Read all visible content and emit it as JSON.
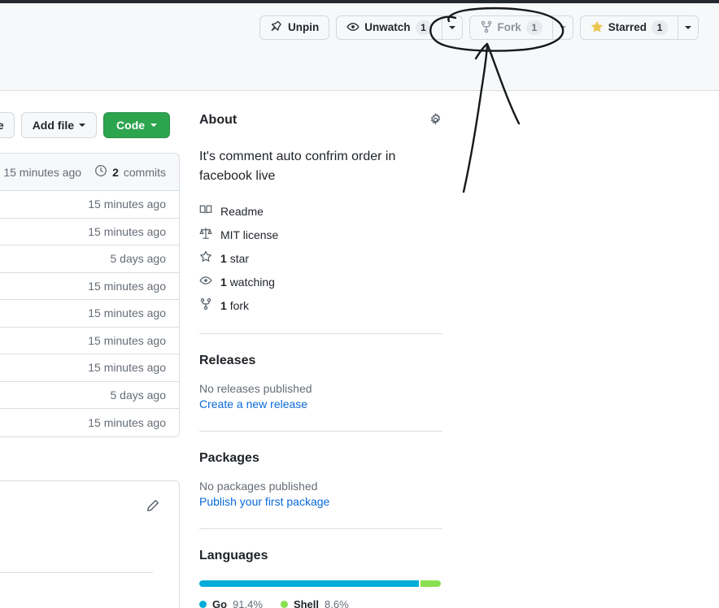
{
  "header": {
    "buttons": [
      {
        "id": "unpin",
        "label": "Unpin",
        "icon": "pin-icon",
        "count": null,
        "has_caret": false,
        "state": "enabled",
        "style": "default"
      },
      {
        "id": "unwatch",
        "label": "Unwatch",
        "icon": "eye-icon",
        "count": "1",
        "has_caret": true,
        "state": "enabled",
        "style": "default"
      },
      {
        "id": "fork",
        "label": "Fork",
        "icon": "fork-icon",
        "count": "1",
        "has_caret": true,
        "state": "disabled",
        "style": "default"
      },
      {
        "id": "starred",
        "label": "Starred",
        "icon": "star-filled-icon",
        "count": "1",
        "has_caret": true,
        "state": "enabled",
        "style": "default"
      }
    ]
  },
  "repo_toolbar": {
    "go_to_file_label": "le",
    "add_file_label": "Add file",
    "code_label": "Code"
  },
  "file_table": {
    "commit_row": {
      "time": "15 minutes ago",
      "history_icon": "history-icon",
      "commit_count": "2",
      "commit_label": "commits"
    },
    "rows": [
      {
        "time": "15 minutes ago"
      },
      {
        "time": "15 minutes ago"
      },
      {
        "time": "5 days ago"
      },
      {
        "time": "15 minutes ago"
      },
      {
        "time": "15 minutes ago"
      },
      {
        "time": "15 minutes ago"
      },
      {
        "time": "15 minutes ago"
      },
      {
        "time": "5 days ago"
      },
      {
        "time": "15 minutes ago"
      }
    ]
  },
  "readme_panel": {
    "edit_icon": "pencil-icon"
  },
  "about": {
    "title": "About",
    "settings_icon": "gear-icon",
    "description": "It's comment auto confrim order in facebook live",
    "items": [
      {
        "icon": "book-icon",
        "text": "Readme",
        "bold_prefix": ""
      },
      {
        "icon": "law-icon",
        "text": "MIT license",
        "bold_prefix": ""
      },
      {
        "icon": "star-icon",
        "text": "star",
        "bold_prefix": "1"
      },
      {
        "icon": "eye-icon",
        "text": "watching",
        "bold_prefix": "1"
      },
      {
        "icon": "fork-icon",
        "text": "fork",
        "bold_prefix": "1"
      }
    ]
  },
  "releases": {
    "title": "Releases",
    "empty_text": "No releases published",
    "link_text": "Create a new release"
  },
  "packages": {
    "title": "Packages",
    "empty_text": "No packages published",
    "link_text": "Publish your first package"
  },
  "languages": {
    "title": "Languages"
  },
  "chart_data": {
    "type": "bar",
    "title": "Languages",
    "orientation": "horizontal-stacked",
    "categories": [
      "Go",
      "Shell"
    ],
    "values": [
      91.4,
      8.6
    ],
    "labels": [
      "91.4%",
      "8.6%"
    ],
    "colors": [
      "#00ADD8",
      "#89e051"
    ],
    "unit": "%",
    "total": 100,
    "legend_position": "bottom"
  },
  "annotation": {
    "type": "hand-drawn",
    "shapes": [
      "ellipse-around-fork-button",
      "arrow-pointing-to-fork-button"
    ],
    "color": "#16181a",
    "target": "fork"
  },
  "colors": {
    "accent_green": "#2da44e",
    "link_blue": "#0969da",
    "header_bg": "#f6f8fa",
    "border": "#d8dee4",
    "go_lang": "#00ADD8",
    "shell_lang": "#89e051",
    "star_gold": "#eac54f"
  }
}
